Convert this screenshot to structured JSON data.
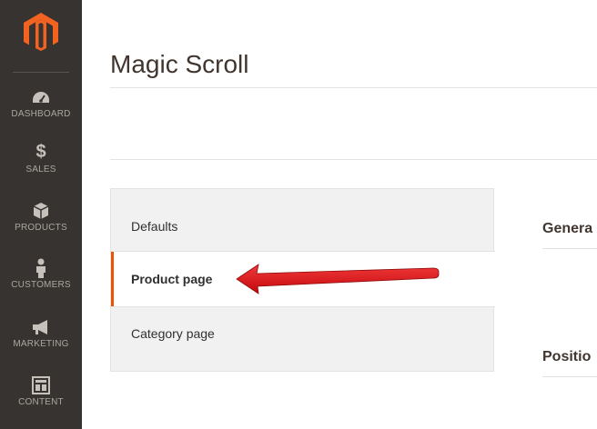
{
  "sidebar": {
    "logo_icon": "magento-logo-icon",
    "items": [
      {
        "label": "DASHBOARD",
        "icon": "speedometer-icon"
      },
      {
        "label": "SALES",
        "icon": "dollar-icon"
      },
      {
        "label": "PRODUCTS",
        "icon": "box-icon"
      },
      {
        "label": "CUSTOMERS",
        "icon": "person-icon"
      },
      {
        "label": "MARKETING",
        "icon": "megaphone-icon"
      },
      {
        "label": "CONTENT",
        "icon": "layout-icon"
      }
    ]
  },
  "header": {
    "title": "Magic Scroll"
  },
  "tabs": [
    {
      "label": "Defaults",
      "active": false
    },
    {
      "label": "Product page",
      "active": true
    },
    {
      "label": "Category page",
      "active": false
    }
  ],
  "sections": [
    {
      "label": "Genera"
    },
    {
      "label": "Positio"
    }
  ],
  "colors": {
    "sidebar_bg": "#373330",
    "accent": "#eb5202",
    "annotation_arrow": "#e3161b"
  }
}
